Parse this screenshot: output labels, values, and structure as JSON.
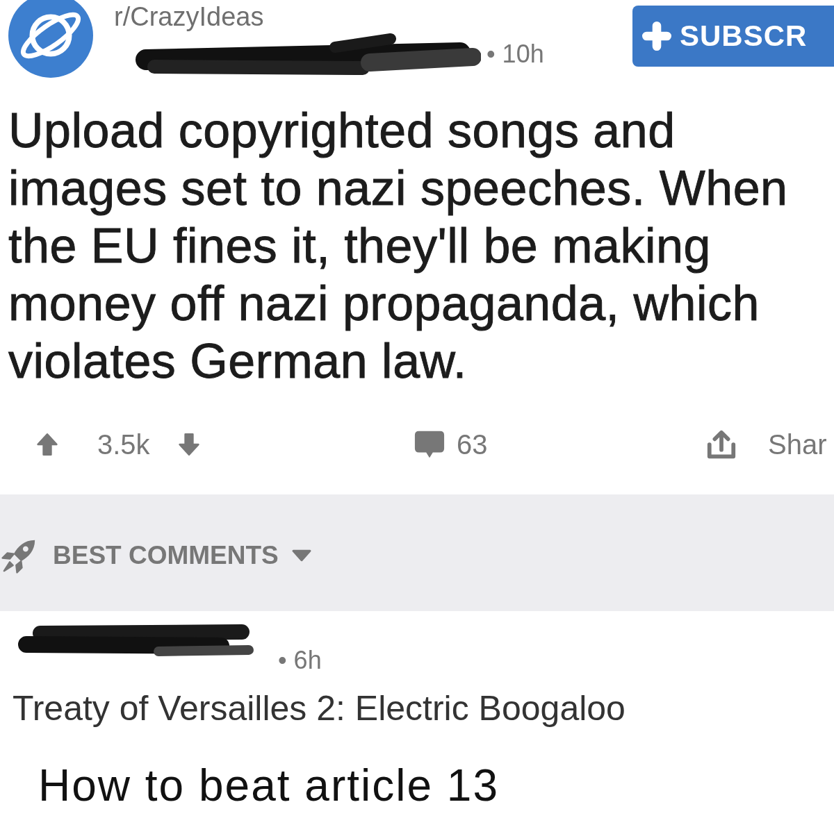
{
  "post": {
    "community": "r/CrazyIdeas",
    "age": "• 10h",
    "subscribe_label": "SUBSCR",
    "title_lines": [
      "Upload copyrighted songs and",
      "images set to nazi speeches. When",
      "the EU fines it, they'll be making",
      "money off nazi propaganda, which",
      "violates German law."
    ],
    "score": "3.5k",
    "comment_count": "63",
    "share_label": "Shar"
  },
  "comment_sort": {
    "label": "BEST COMMENTS"
  },
  "comments": [
    {
      "age": "• 6h",
      "body": "Treaty of Versailles 2: Electric Boogaloo"
    }
  ],
  "caption": "How to beat article 13"
}
